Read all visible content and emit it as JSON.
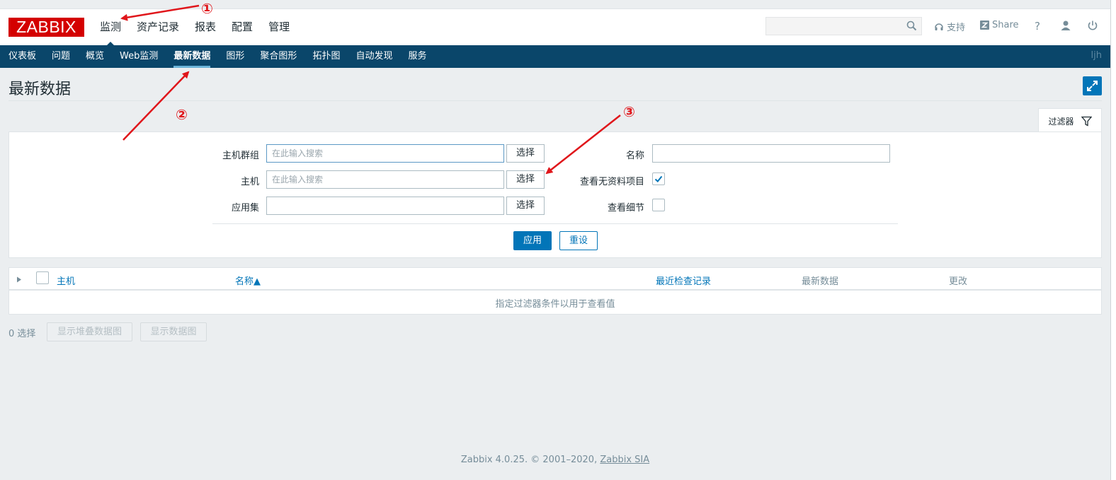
{
  "logo": {
    "text": "ZABBIX"
  },
  "main_menu": [
    "监测",
    "资产记录",
    "报表",
    "配置",
    "管理"
  ],
  "top_right": {
    "support": "支持",
    "share": "Share",
    "help": "?"
  },
  "sub_menu": [
    "仪表板",
    "问题",
    "概览",
    "Web监测",
    "最新数据",
    "图形",
    "聚合图形",
    "拓扑图",
    "自动发现",
    "服务"
  ],
  "user": "ljh",
  "page_title": "最新数据",
  "filter": {
    "tab_label": "过滤器",
    "host_groups_label": "主机群组",
    "hosts_label": "主机",
    "application_label": "应用集",
    "placeholder": "在此输入搜索",
    "select_label": "选择",
    "name_label": "名称",
    "show_without_data_label": "查看无资料项目",
    "show_without_data_checked": true,
    "show_details_label": "查看细节",
    "show_details_checked": false,
    "apply_label": "应用",
    "reset_label": "重设"
  },
  "table": {
    "columns": [
      "主机",
      "名称▲",
      "最近检查记录",
      "最新数据",
      "更改"
    ],
    "empty_message": "指定过滤器条件以用于查看值"
  },
  "selection": {
    "count_text": "0 选择",
    "stacked_graph": "显示堆叠数据图",
    "graph": "显示数据图"
  },
  "footer": {
    "text": "Zabbix 4.0.25. © 2001–2020,",
    "link": "Zabbix SIA"
  },
  "annotations": [
    "①",
    "②",
    "③"
  ],
  "colors": {
    "nav": "#0a466a",
    "accent": "#0275b8",
    "logo": "#d40000",
    "annotation": "#e0161b"
  }
}
